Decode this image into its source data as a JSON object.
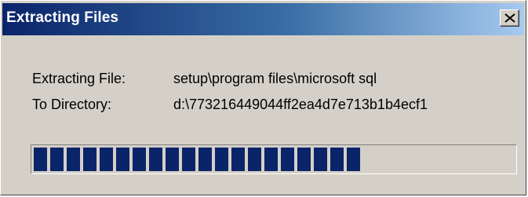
{
  "window": {
    "title": "Extracting Files"
  },
  "details": {
    "file_label": "Extracting File:",
    "file_value": "setup\\program files\\microsoft sql",
    "dir_label": "To Directory:",
    "dir_value": "d:\\773216449044ff2ea4d7e713b1b4ecf1"
  },
  "progress": {
    "blocks_filled": 20,
    "blocks_total": 29,
    "fill_color": "#0a246a"
  },
  "colors": {
    "title_gradient_start": "#0a246a",
    "title_gradient_end": "#a6caf0",
    "dialog_bg": "#d4d0c8"
  },
  "icons": {
    "close": "close-icon"
  }
}
